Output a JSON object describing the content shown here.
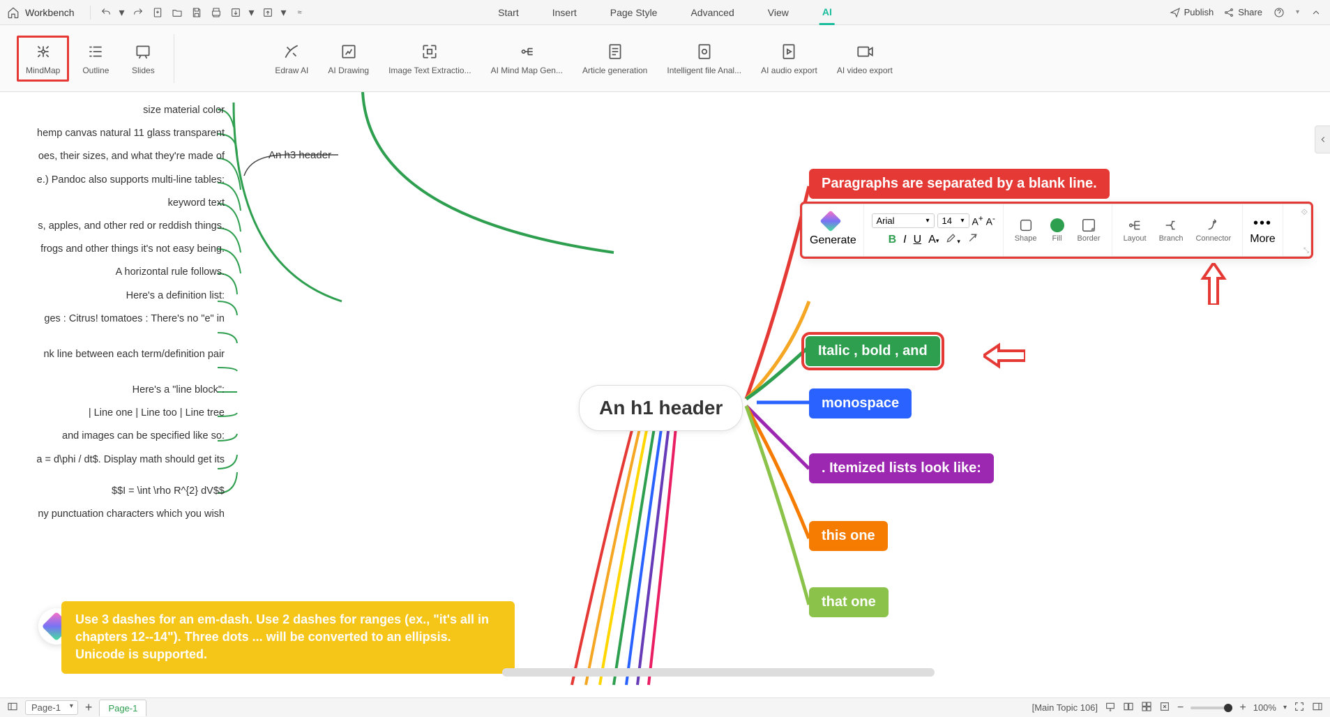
{
  "app": {
    "name": "Workbench"
  },
  "menu": {
    "tabs": [
      "Start",
      "Insert",
      "Page Style",
      "Advanced",
      "View",
      "AI"
    ],
    "active": "AI"
  },
  "ribbon": {
    "left": [
      {
        "label": "MindMap",
        "selected": true
      },
      {
        "label": "Outline"
      },
      {
        "label": "Slides"
      }
    ],
    "ai": [
      {
        "label": "Edraw AI"
      },
      {
        "label": "AI Drawing"
      },
      {
        "label": "Image Text Extractio..."
      },
      {
        "label": "AI Mind Map Gen..."
      },
      {
        "label": "Article generation"
      },
      {
        "label": "Intelligent file Anal..."
      },
      {
        "label": "AI audio export"
      },
      {
        "label": "AI video export"
      }
    ]
  },
  "top_right": {
    "publish": "Publish",
    "share": "Share"
  },
  "left_fragments": [
    "size material color",
    "hemp canvas natural 11 glass transparent",
    "oes, their sizes, and what they're made of",
    "e.) Pandoc also supports multi-line tables:",
    "keyword text",
    "s, apples, and other red or reddish things.",
    "frogs and other things it's not easy being.",
    "A horizontal rule follows.",
    "Here's a definition list:",
    "ges : Citrus! tomatoes : There's no \"e\" in",
    "nk line between each term/definition pair",
    "Here's a \"line block\":",
    "| Line one | Line too | Line tree",
    "and images can be specified like so:",
    "a = d\\phi / dt$. Display math should get its",
    "$$I = \\int \\rho R^{2} dV$$",
    "ny punctuation characters which you wish"
  ],
  "h3_label": "An h3 header",
  "nodes": {
    "center": "An h1 header",
    "red": "Paragraphs are separated by a blank line.",
    "green": "Italic , bold , and",
    "blue": "monospace",
    "purple": ". Itemized lists look like:",
    "orange": "this one",
    "olive": "that one",
    "yellow": "Use 3 dashes for an em-dash. Use 2 dashes for ranges (ex., \"it's all in chapters 12--14\"). Three dots ... will be converted to an ellipsis. Unicode is supported."
  },
  "float_toolbar": {
    "generate": "Generate",
    "font": "Arial",
    "size": "14",
    "shape": "Shape",
    "fill": "Fill",
    "border": "Border",
    "layout": "Layout",
    "branch": "Branch",
    "connector": "Connector",
    "more": "More"
  },
  "bottom": {
    "page_select": "Page-1",
    "page_tab": "Page-1",
    "status": "[Main Topic 106]",
    "zoom": "100%"
  }
}
